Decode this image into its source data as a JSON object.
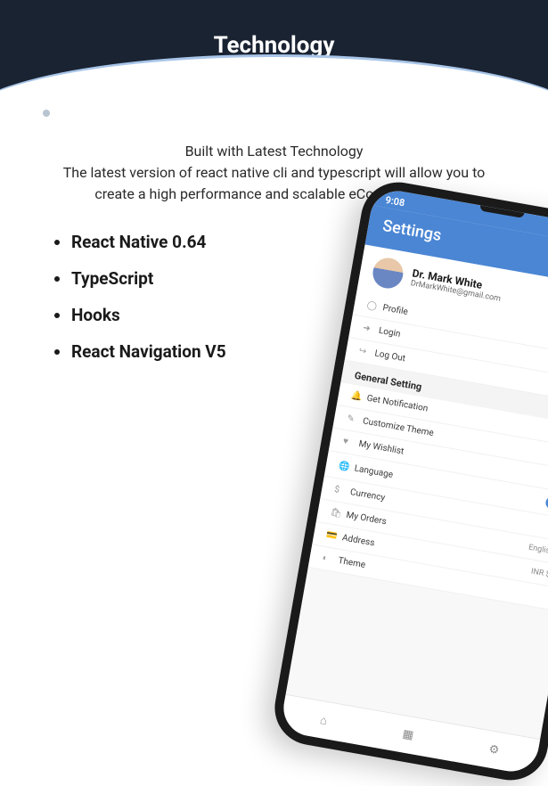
{
  "header": {
    "title": "Technology"
  },
  "subtitle_line1": "Built with Latest Technology",
  "subtitle_line2": "The latest version of react native cli and typescript will allow you to create a high performance and scalable eCommerce app",
  "features": [
    "React Native 0.64",
    "TypeScript",
    "Hooks",
    "React Navigation V5"
  ],
  "phone": {
    "time": "9:08",
    "screen_title": "Settings",
    "user": {
      "name": "Dr. Mark White",
      "email": "DrMarkWhite@gmail.com"
    },
    "menu1": [
      {
        "icon": "user-icon",
        "glyph": "◯",
        "label": "Profile"
      },
      {
        "icon": "login-icon",
        "glyph": "➜",
        "label": "Login"
      },
      {
        "icon": "logout-icon",
        "glyph": "↪",
        "label": "Log Out"
      }
    ],
    "section_title": "General Setting",
    "menu2": [
      {
        "icon": "bell-icon",
        "glyph": "🔔",
        "label": "Get Notification",
        "right_type": "chevron"
      },
      {
        "icon": "theme-icon",
        "glyph": "✎",
        "label": "Customize Theme",
        "right_type": "chevron"
      },
      {
        "icon": "heart-icon",
        "glyph": "♥",
        "label": "My Wishlist",
        "right_type": "chevron"
      },
      {
        "icon": "globe-icon",
        "glyph": "🌐",
        "label": "Language",
        "right_type": "toggle"
      },
      {
        "icon": "dollar-icon",
        "glyph": "$",
        "label": "Currency",
        "right_type": "chevron"
      },
      {
        "icon": "orders-icon",
        "glyph": "🛍",
        "label": "My Orders",
        "right_text": "English",
        "right_type": "chevron"
      },
      {
        "icon": "address-icon",
        "glyph": "💳",
        "label": "Address",
        "right_text": "INR $",
        "right_type": "chevron"
      },
      {
        "icon": "theme2-icon",
        "glyph": "◐",
        "label": "Theme",
        "right_type": "chevron"
      }
    ],
    "nav": [
      {
        "icon": "home-icon",
        "glyph": "⌂"
      },
      {
        "icon": "grid-icon",
        "glyph": "▦"
      },
      {
        "icon": "gear-icon",
        "glyph": "⚙"
      }
    ]
  }
}
